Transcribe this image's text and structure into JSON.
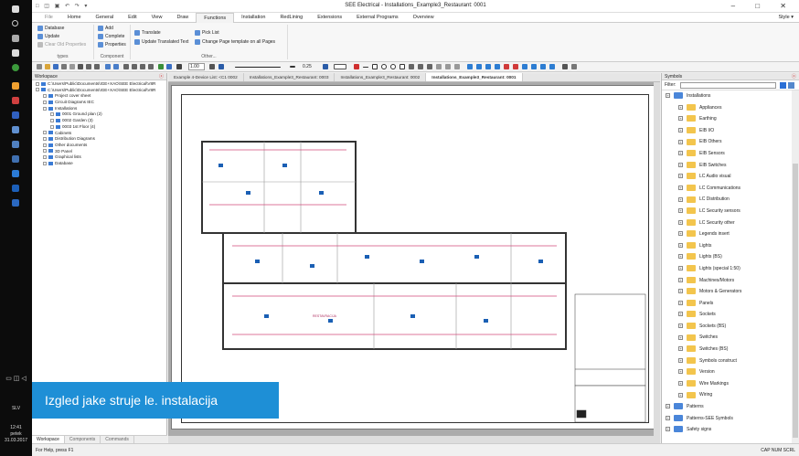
{
  "taskbar": {
    "lang": "SLV",
    "time": "12:41",
    "day": "petek",
    "date": "31.03.2017"
  },
  "window": {
    "title": "SEE Electrical - Installations_Example3_Restaurant: 0001",
    "qat": "□ ◫ ▣ ↶ ↷ ▾"
  },
  "ribbon_tabs": [
    "File",
    "Home",
    "General",
    "Edit",
    "View",
    "Draw",
    "Functions",
    "Installation",
    "RedLining",
    "Extensions",
    "External Programs",
    "Overview"
  ],
  "active_tab": "Functions",
  "style_label": "Style ▾",
  "ribbon": {
    "types": {
      "items": [
        "Database",
        "Update",
        "Clear Old Properties"
      ],
      "label": "types"
    },
    "component": {
      "items": [
        "Add",
        "Complete",
        "Properties"
      ],
      "label": "Component"
    },
    "other": {
      "items": [
        "Translate",
        "Update Translated Text",
        "Pick List",
        "Change Page template on all Pages"
      ],
      "label": "Other..."
    }
  },
  "toolbar": {
    "zoom": "1.00",
    "line_width": "0.25"
  },
  "workspace": {
    "title": "Workspace",
    "tree": [
      {
        "t": "C:\\Users\\Public\\Documents\\IGE+XAO\\SEE Electrical\\V8R",
        "lvl": 0
      },
      {
        "t": "C:\\Users\\Public\\Documents\\IGE+XAO\\SEE Electrical\\V8R",
        "lvl": 0
      },
      {
        "t": "Project cover sheet",
        "lvl": 1
      },
      {
        "t": "Circuit Diagrams IEC",
        "lvl": 1
      },
      {
        "t": "Installations",
        "lvl": 1
      },
      {
        "t": "0001 Ground plan (2)",
        "lvl": 2
      },
      {
        "t": "0002 Garden (3)",
        "lvl": 2
      },
      {
        "t": "0003 1st Floor (4)",
        "lvl": 2
      },
      {
        "t": "Cabinets",
        "lvl": 1
      },
      {
        "t": "Distribution Diagrams",
        "lvl": 1
      },
      {
        "t": "Other documents",
        "lvl": 1
      },
      {
        "t": "3D Panel",
        "lvl": 1
      },
      {
        "t": "Graphical lists",
        "lvl": 1
      },
      {
        "t": "Database",
        "lvl": 1
      }
    ],
    "tabs": [
      "Workspace",
      "Components",
      "Commands"
    ]
  },
  "doc_tabs": [
    "Example 4-Device List: <C1 0002",
    "Installations_Example3_Restaurant: 0003",
    "Installations_Example3_Restaurant: 0002",
    "Installations_Example3_Restaurant: 0001"
  ],
  "plan": {
    "room_label": "RESTAVRACIJA"
  },
  "symbols": {
    "title": "Symbols",
    "filter_label": "Filter:",
    "root": "Installations",
    "items": [
      "Appliances",
      "Earthing",
      "EIB I/O",
      "EIB Others",
      "EIB Sensors",
      "EIB Switches",
      "LC Audio visual",
      "LC Communications",
      "LC Distribution",
      "LC Security sensors",
      "LC Security other",
      "Legends insert",
      "Lights",
      "Lights (BS)",
      "Lights (special 1:50)",
      "Machines/Motors",
      "Motors & Generators",
      "Panels",
      "Sockets",
      "Sockets (BS)",
      "Switches",
      "Switches (BS)",
      "Symbols construct",
      "Version",
      "Wire Markings",
      "Wiring"
    ],
    "tail": [
      "Patterns",
      "Patterns-SEE Symbols",
      "Safety signs"
    ]
  },
  "status": {
    "help": "For Help, press F1",
    "caps": "CAP NUM SCRL"
  },
  "caption": "Izgled jake struje le. instalacija"
}
